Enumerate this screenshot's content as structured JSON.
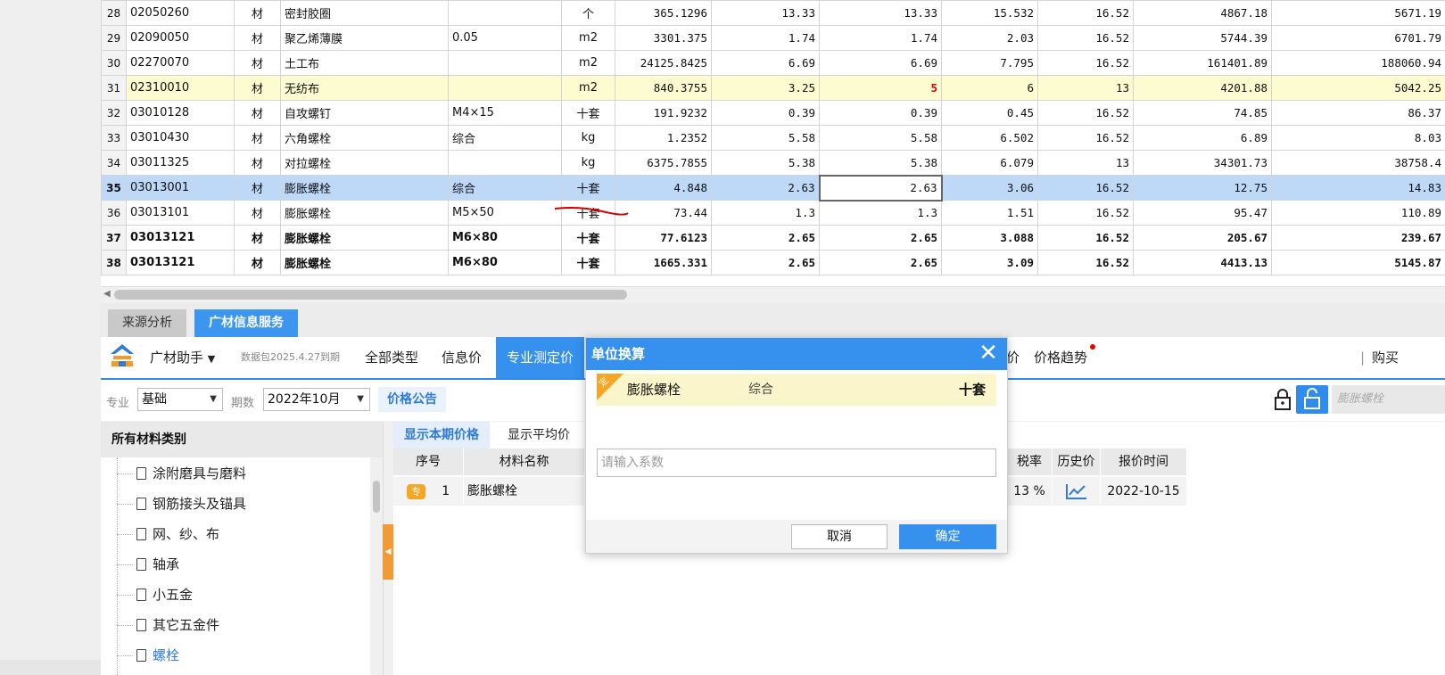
{
  "grid": {
    "rows": [
      {
        "idx": "28",
        "code": "02050260",
        "type": "材",
        "name": "密封胶圈",
        "spec": "",
        "unit": "个",
        "qty": "365.1296",
        "p1": "13.33",
        "p2": "13.33",
        "p3": "15.532",
        "tax": "16.52",
        "amt1": "4867.18",
        "amt2": "5671.19"
      },
      {
        "idx": "29",
        "code": "02090050",
        "type": "材",
        "name": "聚乙烯薄膜",
        "spec": "0.05",
        "unit": "m2",
        "qty": "3301.375",
        "p1": "1.74",
        "p2": "1.74",
        "p3": "2.03",
        "tax": "16.52",
        "amt1": "5744.39",
        "amt2": "6701.79"
      },
      {
        "idx": "30",
        "code": "02270070",
        "type": "材",
        "name": "土工布",
        "spec": "",
        "unit": "m2",
        "qty": "24125.8425",
        "p1": "6.69",
        "p2": "6.69",
        "p3": "7.795",
        "tax": "16.52",
        "amt1": "161401.89",
        "amt2": "188060.94"
      },
      {
        "idx": "31",
        "code": "02310010",
        "type": "材",
        "name": "无纺布",
        "spec": "",
        "unit": "m2",
        "qty": "840.3755",
        "p1": "3.25",
        "p2": "5",
        "p3": "6",
        "tax": "13",
        "amt1": "4201.88",
        "amt2": "5042.25"
      },
      {
        "idx": "32",
        "code": "03010128",
        "type": "材",
        "name": "自攻螺钉",
        "spec": "M4×15",
        "unit": "十套",
        "qty": "191.9232",
        "p1": "0.39",
        "p2": "0.39",
        "p3": "0.45",
        "tax": "16.52",
        "amt1": "74.85",
        "amt2": "86.37"
      },
      {
        "idx": "33",
        "code": "03010430",
        "type": "材",
        "name": "六角螺栓",
        "spec": "综合",
        "unit": "kg",
        "qty": "1.2352",
        "p1": "5.58",
        "p2": "5.58",
        "p3": "6.502",
        "tax": "16.52",
        "amt1": "6.89",
        "amt2": "8.03"
      },
      {
        "idx": "34",
        "code": "03011325",
        "type": "材",
        "name": "对拉螺栓",
        "spec": "",
        "unit": "kg",
        "qty": "6375.7855",
        "p1": "5.38",
        "p2": "5.38",
        "p3": "6.079",
        "tax": "13",
        "amt1": "34301.73",
        "amt2": "38758.4"
      },
      {
        "idx": "35",
        "code": "03013001",
        "type": "材",
        "name": "膨胀螺栓",
        "spec": "综合",
        "unit": "十套",
        "qty": "4.848",
        "p1": "2.63",
        "p2": "2.63",
        "p3": "3.06",
        "tax": "16.52",
        "amt1": "12.75",
        "amt2": "14.83"
      },
      {
        "idx": "36",
        "code": "03013101",
        "type": "材",
        "name": "膨胀螺栓",
        "spec": "M5×50",
        "unit": "十套",
        "qty": "73.44",
        "p1": "1.3",
        "p2": "1.3",
        "p3": "1.51",
        "tax": "16.52",
        "amt1": "95.47",
        "amt2": "110.89"
      },
      {
        "idx": "37",
        "code": "03013121",
        "type": "材",
        "name": "膨胀螺栓",
        "spec": "M6×80",
        "unit": "十套",
        "qty": "77.6123",
        "p1": "2.65",
        "p2": "2.65",
        "p3": "3.088",
        "tax": "16.52",
        "amt1": "205.67",
        "amt2": "239.67"
      },
      {
        "idx": "38",
        "code": "03013121",
        "type": "材",
        "name": "膨胀螺栓",
        "spec": "M6×80",
        "unit": "十套",
        "qty": "1665.331",
        "p1": "2.65",
        "p2": "2.65",
        "p3": "3.09",
        "tax": "16.52",
        "amt1": "4413.13",
        "amt2": "5145.87"
      }
    ]
  },
  "bottom_tabs": {
    "source": "来源分析",
    "gc": "广材信息服务"
  },
  "toolbar": {
    "assistant": "广材助手",
    "data_expiry": "数据包2025.4.27到期",
    "all_types": "全部类型",
    "info_price": "信息价",
    "professional_price": "专业测定价",
    "partial_hidden": "价",
    "price_trend": "价格趋势",
    "buy": "购买"
  },
  "filter": {
    "major_label": "专业",
    "major_value": "基础",
    "period_label": "期数",
    "period_value": "2022年10月",
    "notice_button": "价格公告",
    "search_placeholder": "膨胀螺栓"
  },
  "categories": {
    "header": "所有材料类别",
    "items": [
      "涂附磨具与磨料",
      "钢筋接头及锚具",
      "网、纱、布",
      "轴承",
      "小五金",
      "其它五金件",
      "螺栓"
    ]
  },
  "results": {
    "tab_current": "显示本期价格",
    "tab_average": "显示平均价",
    "headers": {
      "seq": "序号",
      "name": "材料名称",
      "tax": "税率",
      "history": "历史价",
      "time": "报价时间"
    },
    "row": {
      "badge": "专",
      "seq": "1",
      "name": "膨胀螺栓",
      "tax": "13 %",
      "time": "2022-10-15"
    }
  },
  "dialog": {
    "title": "单位换算",
    "corner": "定",
    "item_name": "膨胀螺栓",
    "item_spec": "综合",
    "item_unit": "十套",
    "input_placeholder": "请输入系数",
    "cancel": "取消",
    "ok": "确定"
  },
  "colors": {
    "accent": "#3590ee",
    "selected_row": "#bed8f8",
    "highlight_row": "#fdfbd0",
    "badge": "#f5a623"
  }
}
